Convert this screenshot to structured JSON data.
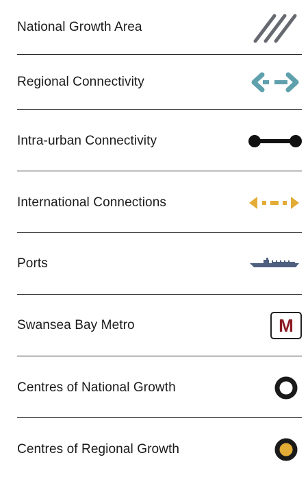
{
  "legend": {
    "items": [
      {
        "label": "National Growth Area",
        "icon": "hatch-lines-icon"
      },
      {
        "label": "Regional Connectivity",
        "icon": "double-arrow-dashed-icon"
      },
      {
        "label": "Intra-urban Connectivity",
        "icon": "connector-line-icon"
      },
      {
        "label": "International Connections",
        "icon": "dotted-arrow-icon"
      },
      {
        "label": "Ports",
        "icon": "ship-icon"
      },
      {
        "label": "Swansea Bay Metro",
        "icon": "metro-icon",
        "letter": "M"
      },
      {
        "label": "Centres of National Growth",
        "icon": "ring-icon"
      },
      {
        "label": "Centres of Regional Growth",
        "icon": "filled-ring-icon"
      }
    ]
  },
  "colors": {
    "text": "#1a1a1a",
    "divider": "#2b2b2b",
    "hatch": "#666a70",
    "regional_teal": "#5fa0ad",
    "intra_black": "#111111",
    "international_gold": "#e2ac36",
    "port_blue": "#4e607e",
    "metro_red": "#8b1c22",
    "regional_centre_fill": "#e2ac36"
  }
}
